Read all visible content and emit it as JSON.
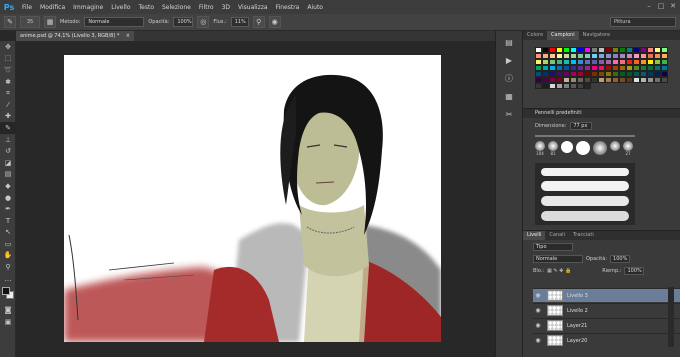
{
  "app": {
    "logo": "Ps"
  },
  "menu": [
    "File",
    "Modifica",
    "Immagine",
    "Livello",
    "Testo",
    "Selezione",
    "Filtro",
    "3D",
    "Visualizza",
    "Finestra",
    "Aiuto"
  ],
  "options": {
    "brush_size": "35",
    "mode_label": "Metodo:",
    "mode_value": "Normale",
    "opacity_label": "Opacità:",
    "opacity_value": "100%",
    "flow_label": "Flus.:",
    "flow_value": "11%",
    "workspace": "Pittura"
  },
  "document": {
    "tab_title": "anime.psd @ 74,1% (Livello 3, RGB/8) *"
  },
  "panels": {
    "top_tabs": [
      "Colore",
      "Campioni",
      "Navigatore"
    ],
    "brush_presets_title": "Pennelli predefiniti",
    "dimension_label": "Dimensione:",
    "dimension_value": "77 px",
    "brush_sizes": [
      "104",
      "81",
      "",
      "",
      "",
      "",
      "27"
    ],
    "layers_tabs": [
      "Livelli",
      "Canali",
      "Tracciati"
    ],
    "kind_label": "Tipo",
    "blend_mode": "Normale",
    "opacity_label": "Opacità:",
    "opacity_value": "100%",
    "lock_label": "Blo.:",
    "fill_label": "Riemp.:",
    "fill_value": "100%",
    "layers": [
      {
        "name": "Livello 3",
        "selected": true
      },
      {
        "name": "Livello 2",
        "selected": false
      },
      {
        "name": "Layer21",
        "selected": false
      },
      {
        "name": "Layer20",
        "selected": false
      }
    ]
  },
  "swatch_colors": [
    "#ffffff",
    "#000000",
    "#ff0000",
    "#ffff00",
    "#00ff00",
    "#00ffff",
    "#0000ff",
    "#ff00ff",
    "#808080",
    "#c0c0c0",
    "#800000",
    "#808000",
    "#008000",
    "#008080",
    "#000080",
    "#800080",
    "#ff8080",
    "#ffff80",
    "#80ff80",
    "#f7977a",
    "#f9ad81",
    "#fdc68a",
    "#fff79a",
    "#c4df9b",
    "#a3d39c",
    "#82ca9d",
    "#7bcdc8",
    "#6ecff6",
    "#7ea7d8",
    "#8493ca",
    "#8882be",
    "#a187be",
    "#bc8dbf",
    "#f49ac2",
    "#f6989d",
    "#f26c4f",
    "#f68e55",
    "#fbaf5c",
    "#fff467",
    "#acd372",
    "#7cc576",
    "#3bb878",
    "#1abbb4",
    "#00bff3",
    "#438cca",
    "#5574b9",
    "#605ca8",
    "#855fa8",
    "#a763a8",
    "#f06ea9",
    "#f26d7d",
    "#ed1c24",
    "#f26522",
    "#f7941d",
    "#fff200",
    "#8dc73f",
    "#39b54a",
    "#00a651",
    "#00a99d",
    "#00aeef",
    "#0072bc",
    "#0054a6",
    "#2e3192",
    "#662d91",
    "#92278f",
    "#ec008c",
    "#ed145b",
    "#9e0b0f",
    "#a0410d",
    "#a3620a",
    "#aba000",
    "#598527",
    "#1a7b30",
    "#007236",
    "#00746b",
    "#0076a3",
    "#004b80",
    "#003471",
    "#1b1464",
    "#440e62",
    "#630460",
    "#9e005d",
    "#9e0039",
    "#790000",
    "#7b2e00",
    "#7d4900",
    "#827b00",
    "#406618",
    "#005e20",
    "#005826",
    "#005952",
    "#005b7f",
    "#003663",
    "#002157",
    "#0d004c",
    "#32004b",
    "#4b0049",
    "#7b0046",
    "#7a0026",
    "#c7b299",
    "#998675",
    "#736357",
    "#534741",
    "#37302d",
    "#c69c6d",
    "#a67c52",
    "#8c6239",
    "#754c24",
    "#603913",
    "#e1e1e1",
    "#b4b4b4",
    "#959595",
    "#6f6f6f",
    "#4b4b4b",
    "#363636",
    "#1e1e1e",
    "#d9d9d9",
    "#a6a6a6",
    "#7f7f7f",
    "#595959",
    "#404040",
    "#262626"
  ]
}
